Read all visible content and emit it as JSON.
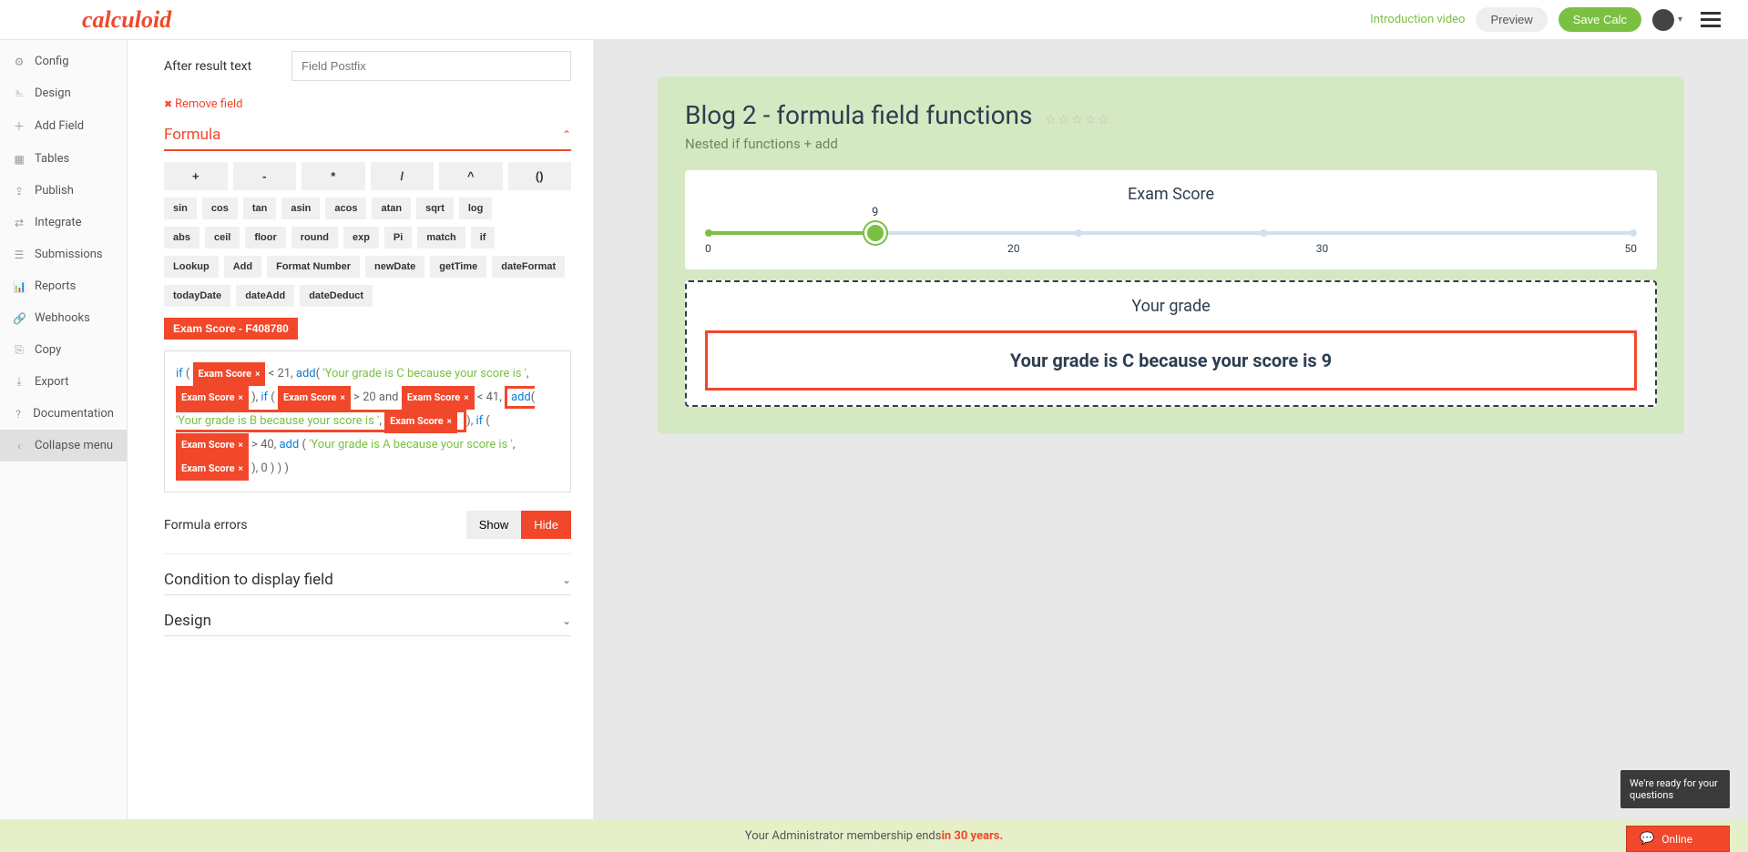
{
  "header": {
    "logo": "calculoid",
    "intro_link": "Introduction video",
    "preview": "Preview",
    "save": "Save Calc"
  },
  "sidebar": {
    "items": [
      {
        "icon": "⚙",
        "label": "Config"
      },
      {
        "icon": "⎁",
        "label": "Design"
      },
      {
        "icon": "＋",
        "label": "Add Field"
      },
      {
        "icon": "▦",
        "label": "Tables"
      },
      {
        "icon": "⇪",
        "label": "Publish"
      },
      {
        "icon": "⇄",
        "label": "Integrate"
      },
      {
        "icon": "☰",
        "label": "Submissions"
      },
      {
        "icon": "📊",
        "label": "Reports"
      },
      {
        "icon": "🔗",
        "label": "Webhooks"
      },
      {
        "icon": "⎘",
        "label": "Copy"
      },
      {
        "icon": "⤓",
        "label": "Export"
      },
      {
        "icon": "?",
        "label": "Documentation"
      },
      {
        "icon": "‹",
        "label": "Collapse menu"
      }
    ]
  },
  "editor": {
    "after_result_label": "After result text",
    "after_result_placeholder": "Field Postfix",
    "remove_field": "Remove field",
    "formula_title": "Formula",
    "operators": [
      "+",
      "-",
      "*",
      "/",
      "^",
      "()"
    ],
    "functions1": [
      "sin",
      "cos",
      "tan",
      "asin",
      "acos",
      "atan",
      "sqrt",
      "log"
    ],
    "functions2": [
      "abs",
      "ceil",
      "floor",
      "round",
      "exp",
      "Pi",
      "match",
      "if"
    ],
    "functions3": [
      "Lookup",
      "Add",
      "Format Number",
      "newDate",
      "getTime",
      "dateFormat"
    ],
    "functions4": [
      "todayDate",
      "dateAdd",
      "dateDeduct"
    ],
    "field_tag": "Exam Score - F408780",
    "formula": {
      "if": "if",
      "add": "add",
      "tag": "Exam Score",
      "tag_x": "×",
      "lt21": " < 21, ",
      "strC": "'Your grade is C because your score is '",
      "comma_sp": ", ",
      "close_if": "), ",
      "open": "( ",
      "gt20_and": " > 20 and ",
      "lt41": " < 41, ",
      "strB": "'Your grade is B because your score is '",
      "if_open_sp": " ( ",
      "gt40": " > 40, ",
      "add_sp": " ( ",
      "strA": "'Your grade is A because your score is '",
      "end": "), 0 ) ) )"
    },
    "errors_label": "Formula errors",
    "show": "Show",
    "hide": "Hide",
    "condition_title": "Condition to display field",
    "design_title": "Design"
  },
  "preview": {
    "title": "Blog 2 - formula field functions",
    "subtitle": "Nested if functions + add",
    "stars": "☆☆☆☆☆",
    "score_title": "Exam Score",
    "slider": {
      "value": 9,
      "min": 0,
      "max": 50,
      "ticks": [
        "0",
        "20",
        "30",
        "50"
      ],
      "pct": 18,
      "dots": [
        40,
        60
      ]
    },
    "grade_title": "Your grade",
    "grade_text": "Your grade is C because your score is 9"
  },
  "footer": {
    "prefix": "Your Administrator membership ends ",
    "years": "in 30 years."
  },
  "chat": {
    "tip": "We're ready for your questions",
    "status": "Online"
  }
}
